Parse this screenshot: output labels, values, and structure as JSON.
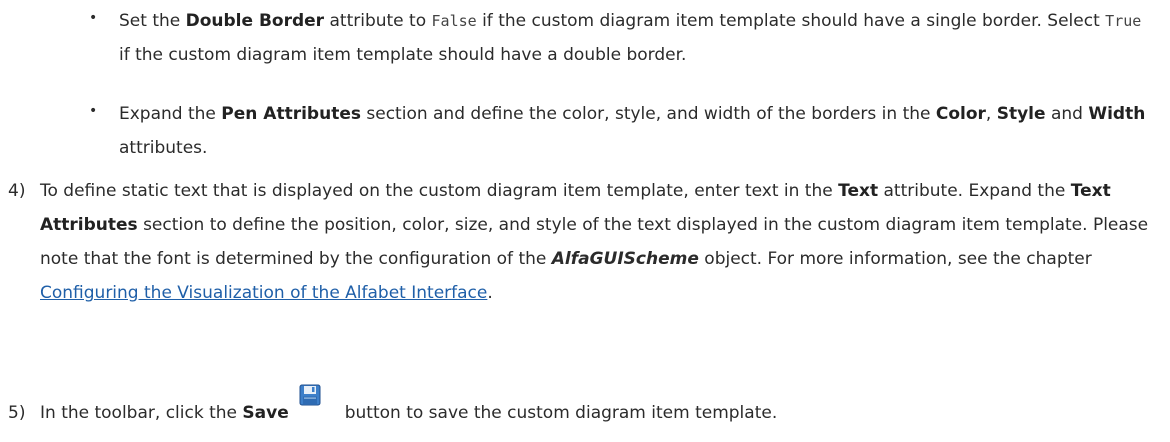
{
  "bullets": [
    {
      "symbol": "•",
      "t1": "Set the ",
      "b1": "Double Border",
      "t2": " attribute to ",
      "code1": "False",
      "t3": " if the custom diagram item template should have a single border. Select ",
      "code2": "True",
      "t4": " if the custom diagram item template should have a double border."
    },
    {
      "symbol": "•",
      "t1": "Expand the ",
      "b1": "Pen Attributes",
      "t2": " section and define the color, style, and width of the borders in the ",
      "b2": "Color",
      "t3": ", ",
      "b3": "Style",
      "t4": " and ",
      "b4": "Width",
      "t5": " attributes."
    }
  ],
  "steps": [
    {
      "number": "4)",
      "t1": "To define static text that is displayed on the custom diagram item template, enter text in the ",
      "b1": "Text",
      "t2": " attribute. Expand the ",
      "b2": "Text Attributes",
      "t3": " section to define the position, color, size, and style of the text displayed in the custom diagram item template. Please note that the font is determined by the configuration of the ",
      "bi1": "AlfaGUIScheme",
      "t4": " object. For more information, see the chapter ",
      "link": "Configuring the Visualization of the Alfabet Interface",
      "t5": "."
    },
    {
      "number": "5)",
      "t1": "In the toolbar, click the ",
      "b1": "Save",
      "icon": "save-icon",
      "t2": "button to save the custom diagram item template."
    }
  ]
}
